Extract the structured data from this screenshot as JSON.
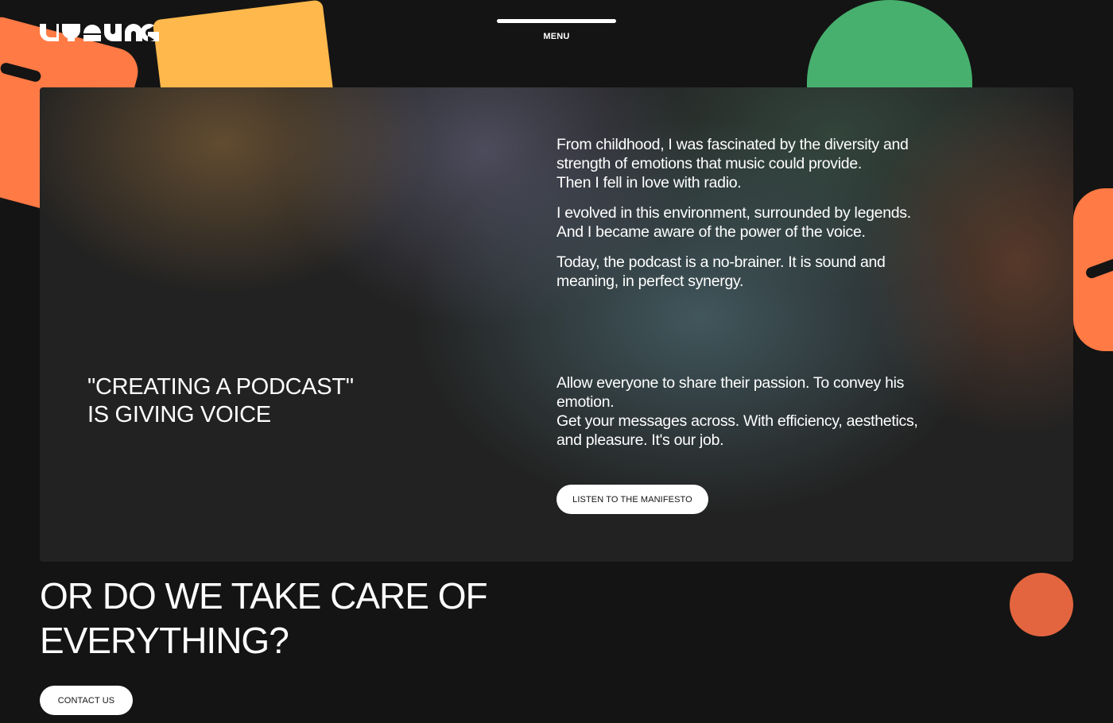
{
  "brand": {
    "logo_icon": "wordmark-logo"
  },
  "menu": {
    "label": "MENU"
  },
  "panel": {
    "quote_lines": [
      "\"CREATING A PODCAST\"",
      "IS GIVING VOICE"
    ],
    "story": [
      [
        "From childhood, I was fascinated by the diversity and",
        "strength of emotions that music could provide.",
        "Then I fell in love with radio."
      ],
      [
        "I evolved in this environment, surrounded by legends.",
        "And I became aware of the power of the voice."
      ],
      [
        "Today, the podcast is a no-brainer. It is sound and",
        "meaning, in perfect synergy."
      ]
    ],
    "mission_lines": [
      "Allow everyone to share their passion. To convey his",
      "emotion.",
      "Get your messages across. With efficiency, aesthetics,",
      "and pleasure. It's our job."
    ],
    "manifesto_button": "LISTEN TO THE MANIFESTO"
  },
  "cta": {
    "heading_lines": [
      "OR DO WE TAKE CARE OF",
      "EVERYTHING?"
    ],
    "contact_button": "CONTACT US"
  },
  "colors": {
    "background": "#141414",
    "orange": "#ff7a45",
    "yellow": "#ffb84c",
    "green": "#47b06e",
    "circle": "#e3653f"
  }
}
